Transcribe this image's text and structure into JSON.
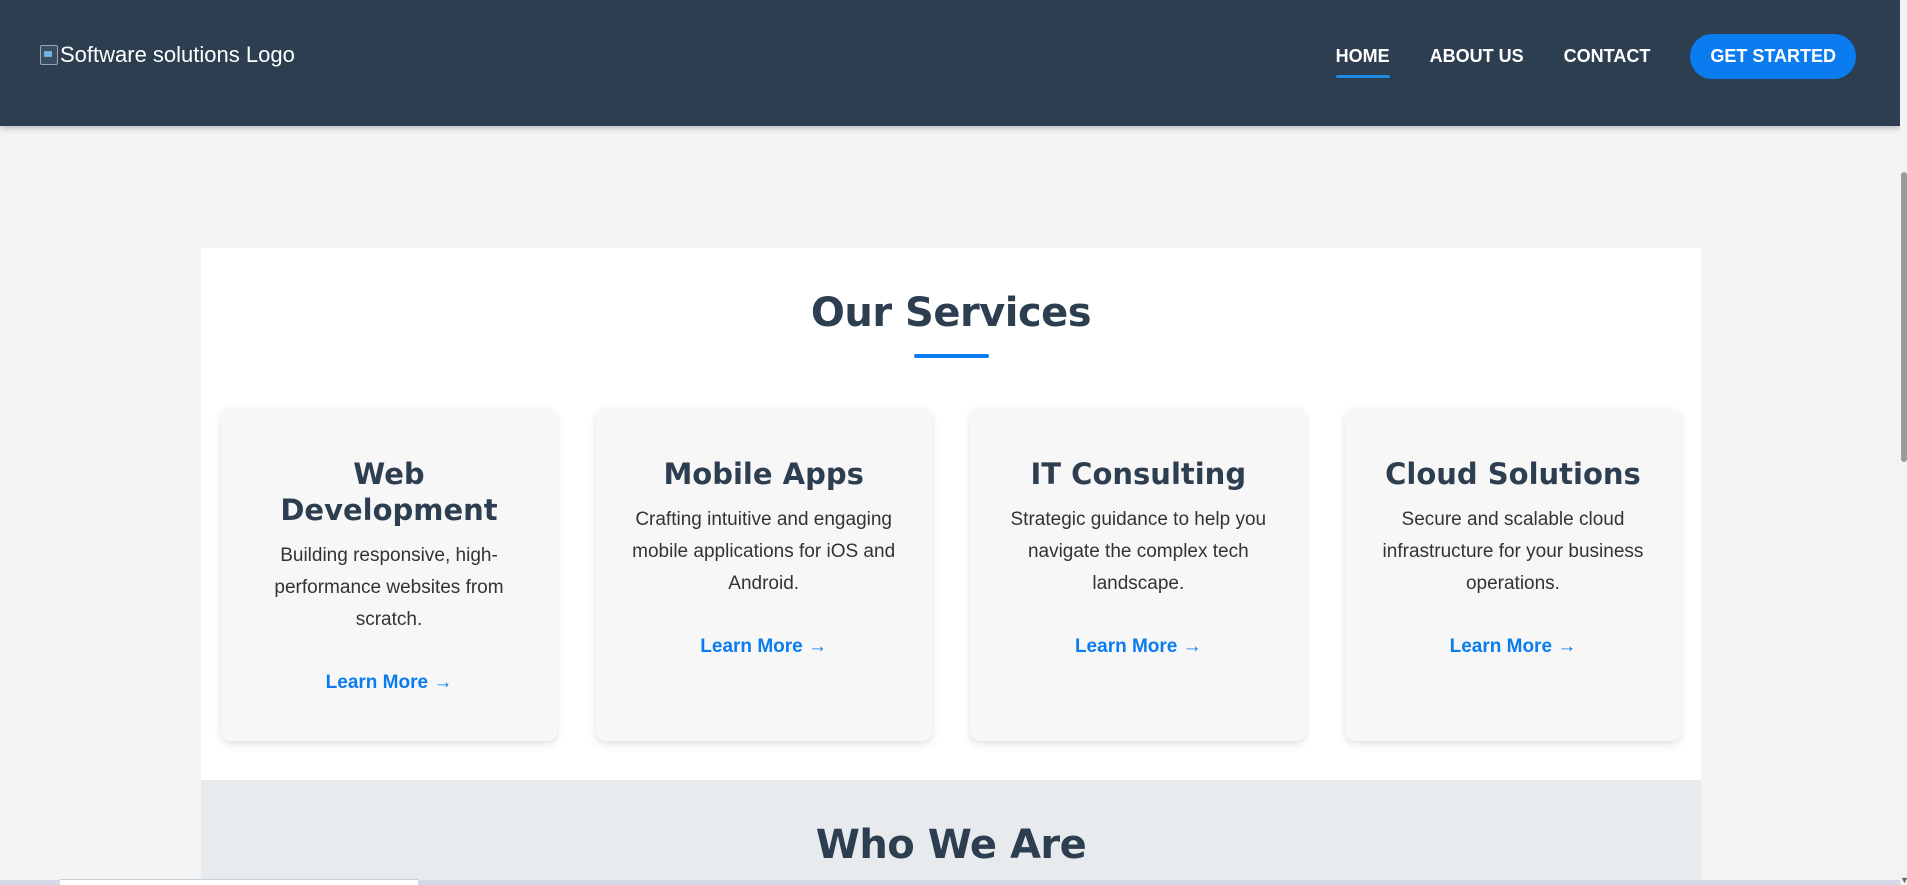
{
  "header": {
    "logo_alt": "Software solutions Logo",
    "nav": [
      {
        "label": "HOME",
        "active": true
      },
      {
        "label": "ABOUT US",
        "active": false
      },
      {
        "label": "CONTACT",
        "active": false
      }
    ],
    "cta_label": "GET STARTED"
  },
  "services": {
    "title": "Our Services",
    "cards": [
      {
        "title": "Web Development",
        "description": "Building responsive, high-performance websites from scratch.",
        "link": "Learn More →"
      },
      {
        "title": "Mobile Apps",
        "description": "Crafting intuitive and engaging mobile applications for iOS and Android.",
        "link": "Learn More →"
      },
      {
        "title": "IT Consulting",
        "description": "Strategic guidance to help you navigate the complex tech landscape.",
        "link": "Learn More →"
      },
      {
        "title": "Cloud Solutions",
        "description": "Secure and scalable cloud infrastructure for your business operations.",
        "link": "Learn More →"
      }
    ]
  },
  "who": {
    "title": "Who We Are"
  },
  "colors": {
    "header_bg": "#2c3e50",
    "accent": "#0a7cf0",
    "page_bg": "#f3f3f3",
    "card_bg": "#f7f7f7",
    "heading": "#2c3e50"
  },
  "icons": {
    "broken_image": "broken-image-icon"
  }
}
